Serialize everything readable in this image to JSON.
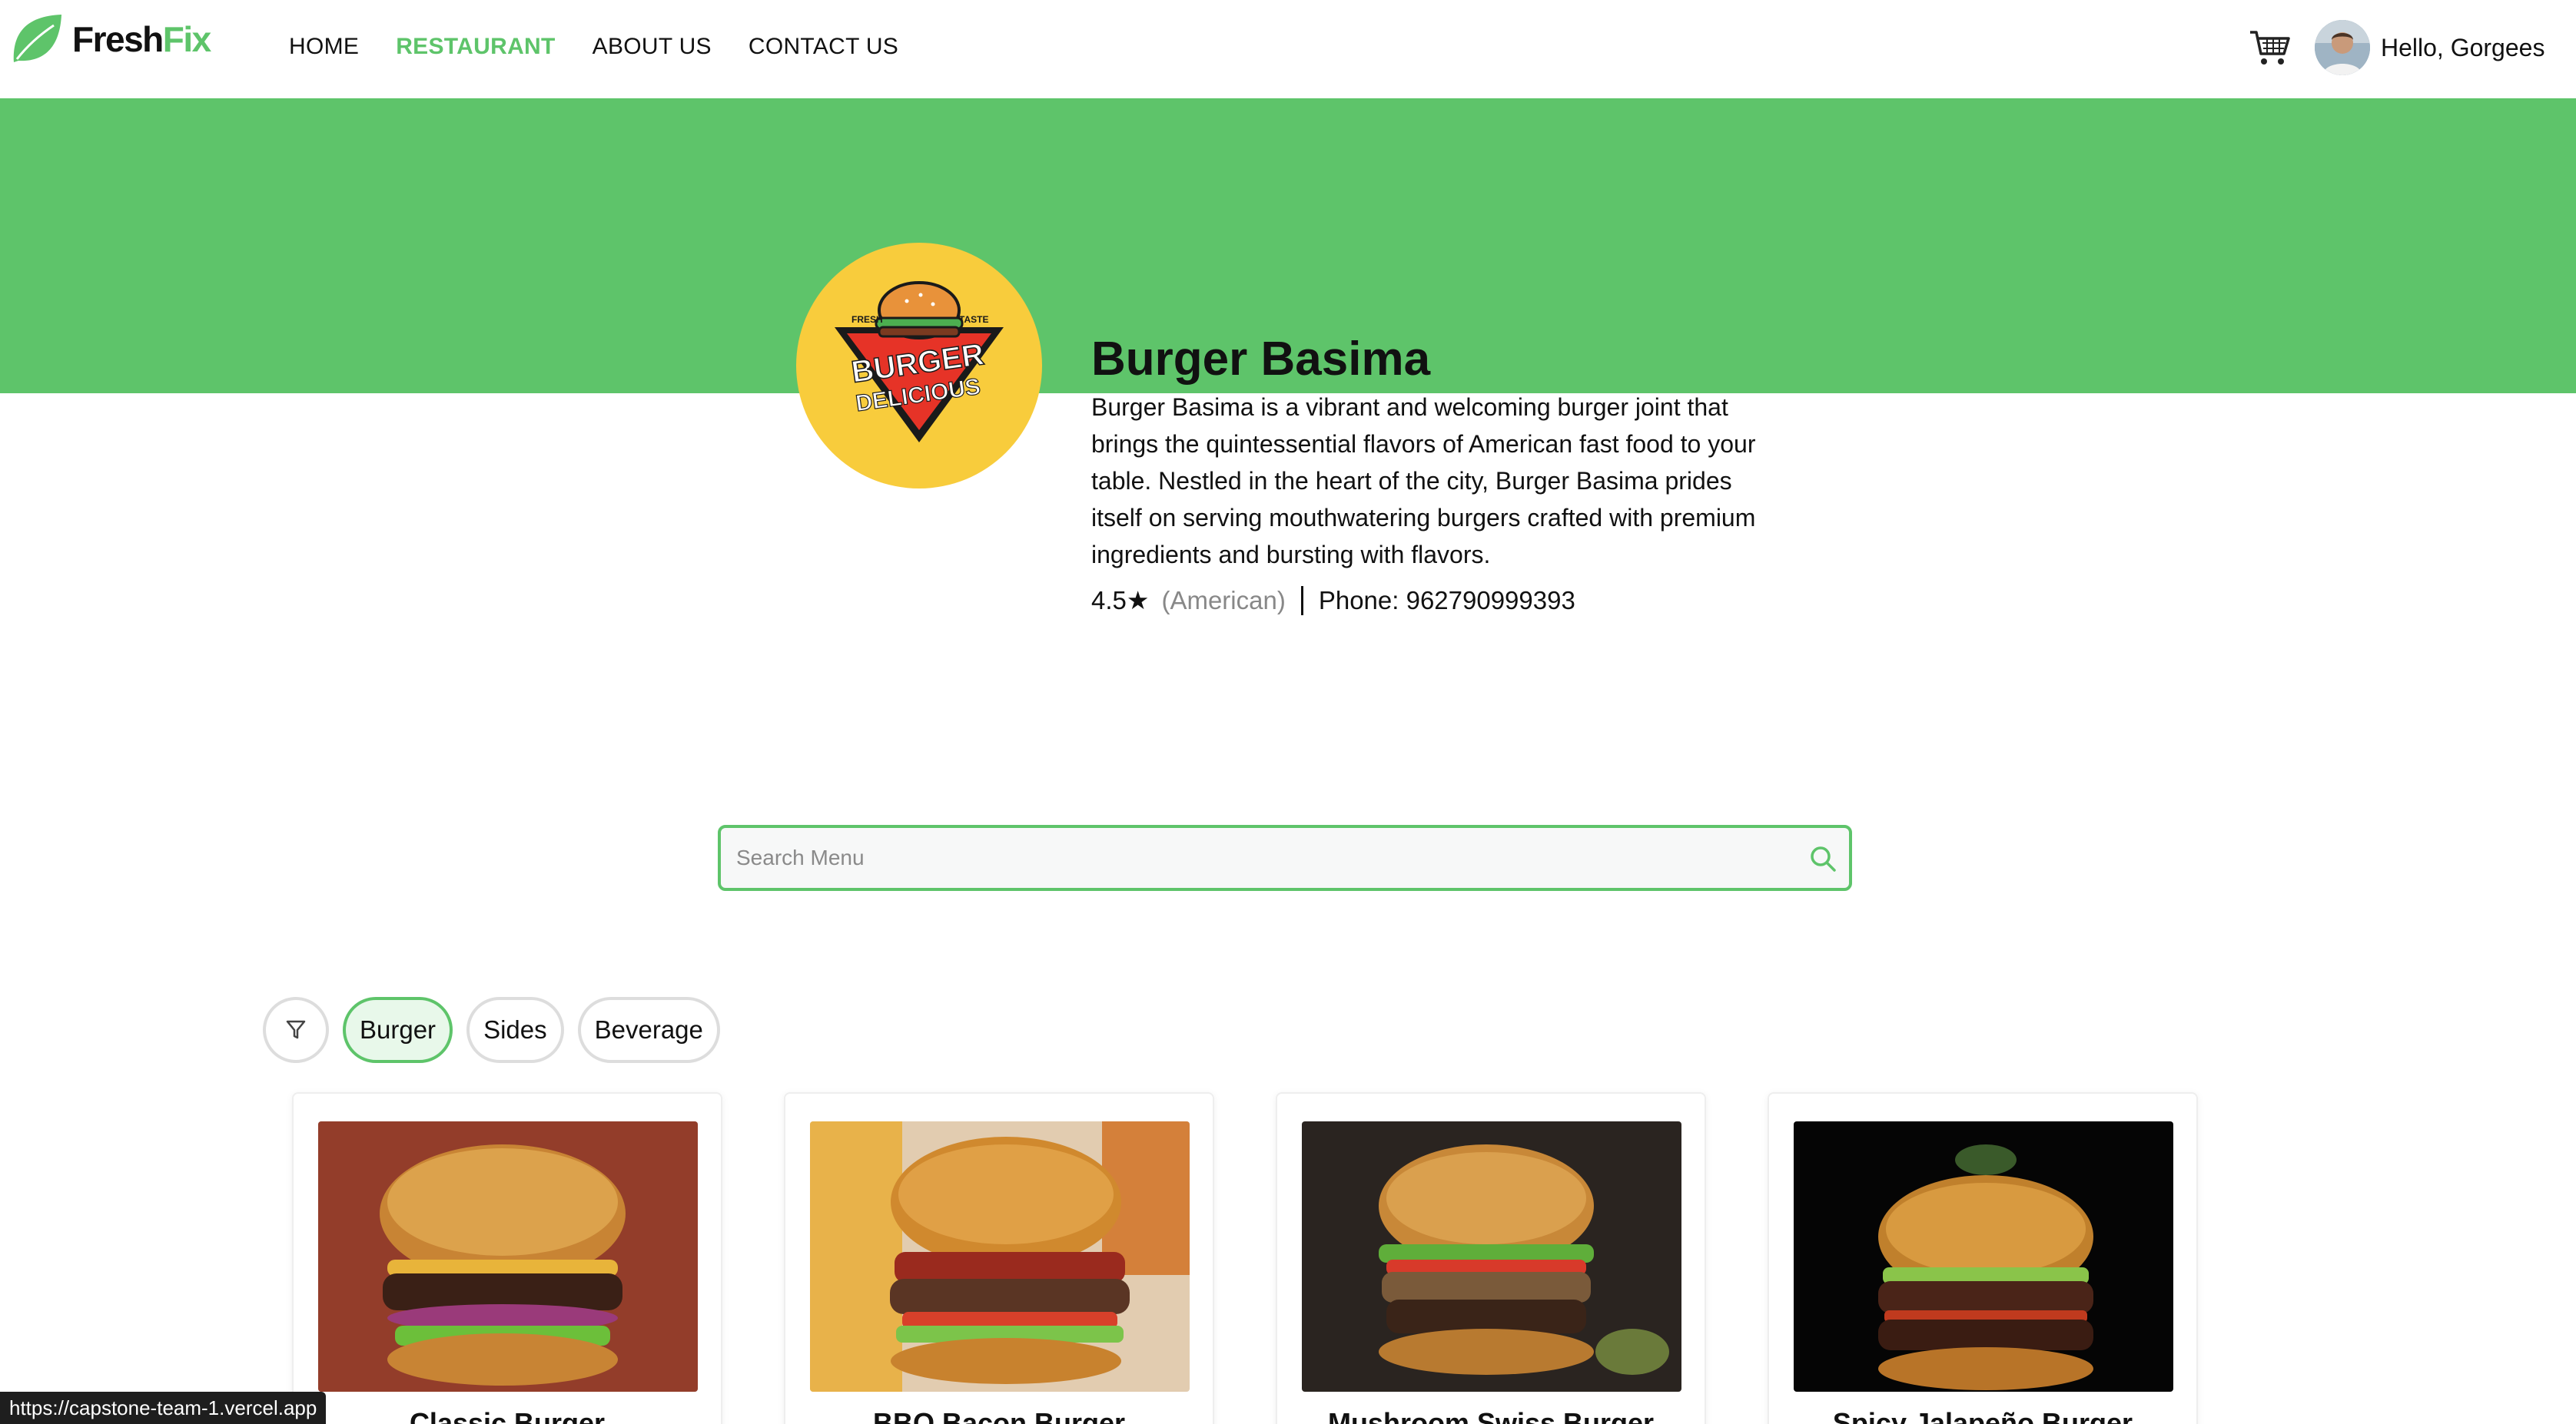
{
  "brand": {
    "name_part1": "Fresh",
    "name_part2": "Fix",
    "accent": "#5ec46a"
  },
  "nav": [
    {
      "label": "HOME",
      "active": false
    },
    {
      "label": "RESTAURANT",
      "active": true
    },
    {
      "label": "ABOUT US",
      "active": false
    },
    {
      "label": "CONTACT US",
      "active": false
    }
  ],
  "header": {
    "greeting": "Hello, Gorgees",
    "cart_icon": "cart-icon"
  },
  "restaurant": {
    "name": "Burger Basima",
    "logo": {
      "top_left": "FRESH",
      "top_right": "TASTE",
      "line1": "BURGER",
      "line2": "DELICIOUS"
    },
    "description": "Burger Basima is a vibrant and welcoming burger joint that brings the quintessential flavors of American fast food to your table. Nestled in the heart of the city, Burger Basima prides itself on serving mouthwatering burgers crafted with premium ingredients and bursting with flavors.",
    "rating": "4.5★",
    "cuisine": "(American)",
    "phone": "Phone: 962790999393"
  },
  "search": {
    "placeholder": "Search Menu",
    "value": ""
  },
  "filters": [
    {
      "label": "Burger",
      "active": true
    },
    {
      "label": "Sides",
      "active": false
    },
    {
      "label": "Beverage",
      "active": false
    }
  ],
  "menu": [
    {
      "name": "Classic Burger",
      "bg": "#8a3a2a"
    },
    {
      "name": "BBQ Bacon Burger",
      "bg": "#d89a4a"
    },
    {
      "name": "Mushroom Swiss Burger",
      "bg": "#2b2622"
    },
    {
      "name": "Spicy Jalapeño Burger",
      "bg": "#050505"
    }
  ],
  "status_url": "https://capstone-team-1.vercel.app"
}
